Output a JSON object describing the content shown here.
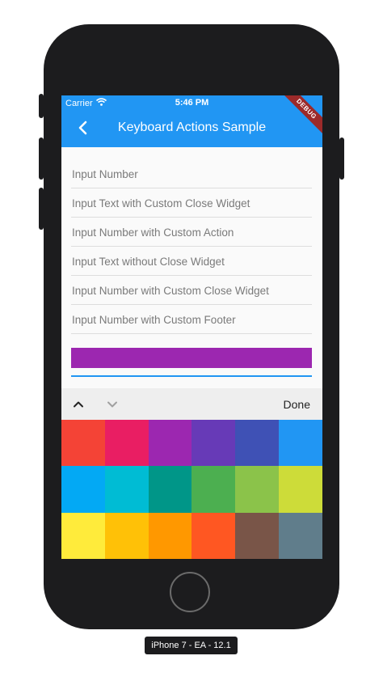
{
  "status_bar": {
    "carrier": "Carrier",
    "time": "5:46 PM",
    "wifi_icon": "wifi-icon"
  },
  "app_bar": {
    "title": "Keyboard Actions Sample",
    "back_icon": "back-arrow-icon",
    "color": "#2196f3"
  },
  "debug_banner": "DEBUG",
  "fields": [
    {
      "placeholder": "Input Number"
    },
    {
      "placeholder": "Input Text with Custom Close Widget"
    },
    {
      "placeholder": "Input Number with Custom Action"
    },
    {
      "placeholder": "Input Text without Close Widget"
    },
    {
      "placeholder": "Input Number with Custom Close Widget"
    },
    {
      "placeholder": "Input Number with Custom Footer"
    }
  ],
  "selected_color": "#9c27b0",
  "keyboard_toolbar": {
    "up_icon": "chevron-up-icon",
    "down_icon": "chevron-down-icon",
    "done_label": "Done"
  },
  "palette": [
    "#f44336",
    "#e91e63",
    "#9c27b0",
    "#673ab7",
    "#3f51b5",
    "#2196f3",
    "#03a9f4",
    "#00bcd4",
    "#009688",
    "#4caf50",
    "#8bc34a",
    "#cddc39",
    "#ffeb3b",
    "#ffc107",
    "#ff9800",
    "#ff5722",
    "#795548",
    "#607d8b"
  ],
  "device_label": "iPhone 7 - EA - 12.1"
}
